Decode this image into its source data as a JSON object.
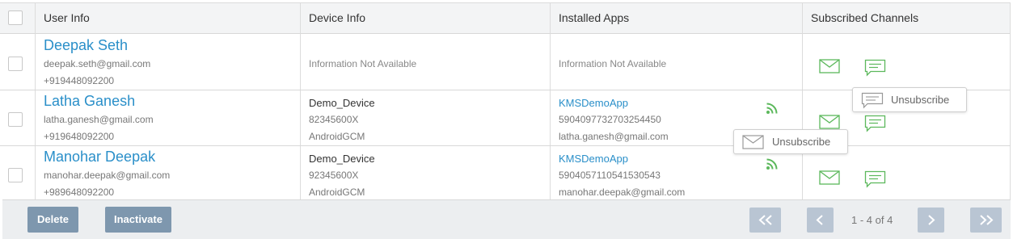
{
  "header": {
    "user_info": "User Info",
    "device_info": "Device Info",
    "installed_apps": "Installed Apps",
    "subscribed_channels": "Subscribed Channels"
  },
  "rows": [
    {
      "name": "Deepak Seth",
      "email": "deepak.seth@gmail.com",
      "phone": "+919448092200",
      "device_na": "Information Not Available",
      "apps_na": "Information Not Available"
    },
    {
      "name": "Latha Ganesh",
      "email": "latha.ganesh@gmail.com",
      "phone": "+919648092200",
      "device_name": "Demo_Device",
      "device_id": "82345600X",
      "device_type": "AndroidGCM",
      "app_name": "KMSDemoApp",
      "app_id": "5904097732703254450",
      "app_email": "latha.ganesh@gmail.com"
    },
    {
      "name": "Manohar Deepak",
      "email": "manohar.deepak@gmail.com",
      "phone": "+989648092200",
      "device_name": "Demo_Device",
      "device_id": "92345600X",
      "device_type": "AndroidGCM",
      "app_name": "KMSDemoApp",
      "app_id": "5904057110541530543",
      "app_email": "manohar.deepak@gmail.com"
    }
  ],
  "tooltips": {
    "sms_unsubscribe": "Unsubscribe",
    "email_unsubscribe": "Unsubscribe"
  },
  "footer": {
    "delete": "Delete",
    "inactivate": "Inactivate",
    "pagination": "1 - 4 of 4"
  },
  "icons": {
    "rss": "rss-icon",
    "email": "envelope-icon",
    "sms": "chat-icon",
    "first": "double-chevron-left-icon",
    "prev": "chevron-left-icon",
    "next": "chevron-right-icon",
    "last": "double-chevron-right-icon"
  },
  "colors": {
    "accent": "#2a8fc9",
    "icon_green": "#5cb85c",
    "button": "#7e97ae",
    "pager_button": "#b9c5d3"
  }
}
